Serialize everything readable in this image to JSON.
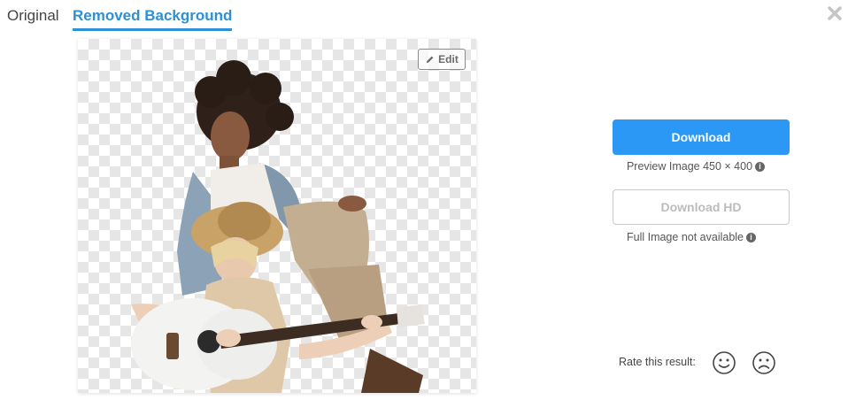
{
  "tabs": {
    "original": "Original",
    "removed": "Removed Background"
  },
  "preview": {
    "edit_label": "Edit",
    "image_alt": "Two women with a guitar, background removed"
  },
  "actions": {
    "download_label": "Download",
    "preview_note": "Preview Image 450 × 400",
    "download_hd_label": "Download HD",
    "full_note": "Full Image not available"
  },
  "rating": {
    "label": "Rate this result:"
  },
  "colors": {
    "accent": "#2b98f5",
    "tab_active": "#2d8fd6",
    "disabled_text": "#bcbcbc"
  },
  "icons": [
    "close-icon",
    "pencil-icon",
    "info-icon",
    "smiley-happy-icon",
    "smiley-sad-icon"
  ]
}
